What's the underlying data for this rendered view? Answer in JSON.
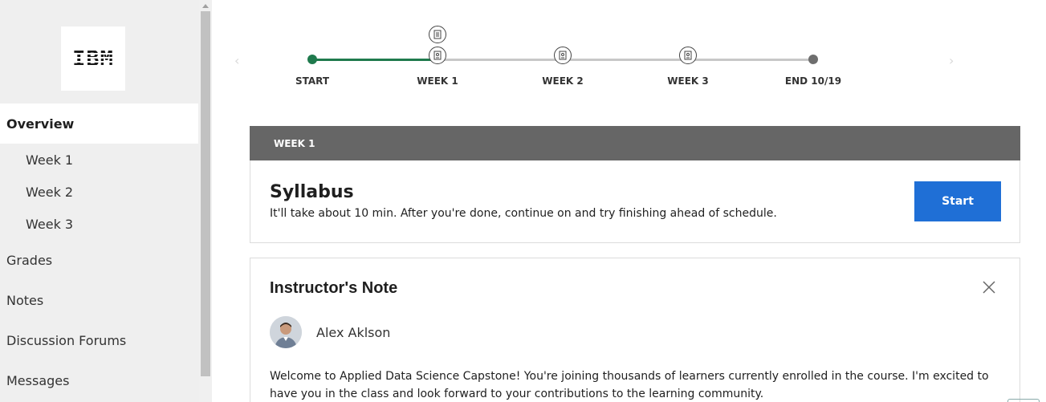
{
  "sidebar": {
    "logo_text": "IBM",
    "items": [
      {
        "label": "Overview",
        "active": true
      },
      {
        "label": "Week 1"
      },
      {
        "label": "Week 2"
      },
      {
        "label": "Week 3"
      },
      {
        "label": "Grades"
      },
      {
        "label": "Notes"
      },
      {
        "label": "Discussion Forums"
      },
      {
        "label": "Messages"
      }
    ]
  },
  "timeline": {
    "nodes": [
      {
        "label": "START"
      },
      {
        "label": "WEEK 1"
      },
      {
        "label": "WEEK 2"
      },
      {
        "label": "WEEK 3"
      },
      {
        "label": "END 10/19"
      }
    ],
    "colors": {
      "progress": "#1f7a4d",
      "remaining": "#c8c8c8",
      "end_dot": "#6e6e6e"
    }
  },
  "week_section": {
    "header": "WEEK 1",
    "syllabus": {
      "title": "Syllabus",
      "description": "It'll take about 10 min. After you're done, continue on and try finishing ahead of schedule.",
      "button_label": "Start"
    }
  },
  "instructor_note": {
    "title": "Instructor's Note",
    "instructor_name": "Alex Aklson",
    "body": "Welcome to Applied Data Science Capstone! You're joining thousands of learners currently enrolled in the course. I'm excited to have you in the class and look forward to your contributions to the learning community."
  },
  "colors": {
    "accent": "#1f6fd6",
    "header_bg": "#666666",
    "sidebar_bg": "#efefef"
  }
}
